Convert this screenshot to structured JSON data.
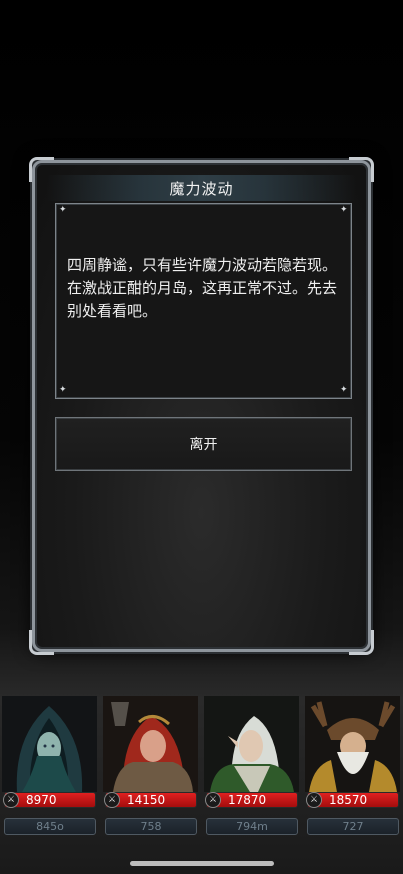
{
  "dialog": {
    "title": "魔力波动",
    "message": "四周静谧，只有些许魔力波动若隐若现。在激战正酣的月岛，这再正常不过。先去别处看看吧。",
    "option_label": "离开"
  },
  "party": [
    {
      "hp": "8970",
      "mp": "845o",
      "hp_icon": "sword-icon"
    },
    {
      "hp": "14150",
      "mp": "758",
      "hp_icon": "sword-icon"
    },
    {
      "hp": "17870",
      "mp": "794m",
      "hp_icon": "sword-icon"
    },
    {
      "hp": "18570",
      "mp": "727",
      "hp_icon": "sword-icon"
    }
  ]
}
